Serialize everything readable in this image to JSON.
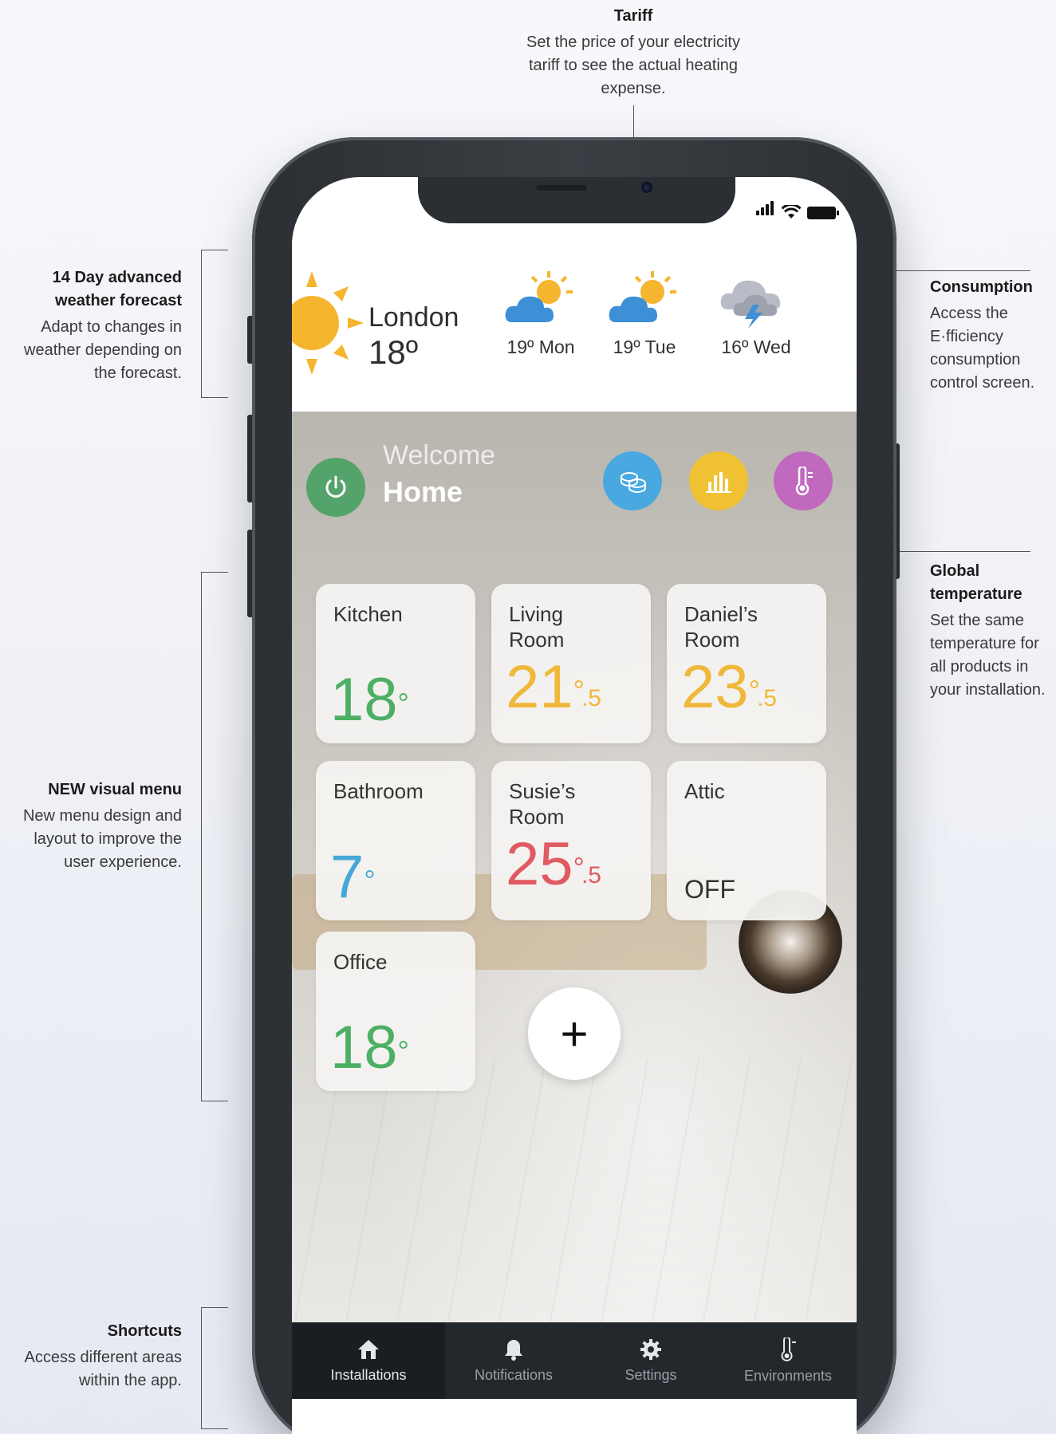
{
  "annotations": {
    "tariff": {
      "title": "Tariff",
      "text": "Set the price of your electricity tariff to see the actual heating expense."
    },
    "weather": {
      "title": "14 Day advanced weather forecast",
      "text": "Adapt to changes in weather depending on the forecast."
    },
    "consumption": {
      "title": "Consumption",
      "text": "Access the E·fficiency consumption control screen."
    },
    "global": {
      "title": "Global temperature",
      "text": "Set the same temperature for all products in your installation."
    },
    "menu": {
      "title": "NEW visual menu",
      "text": "New menu design and layout to improve the user experience."
    },
    "shortcuts": {
      "title": "Shortcuts",
      "text": "Access different areas within the app."
    }
  },
  "weather": {
    "city": "London",
    "temp": "18º",
    "days": [
      {
        "label": "19º Mon",
        "icon": "sun-cloud-icon"
      },
      {
        "label": "19º Tue",
        "icon": "sun-cloud-icon"
      },
      {
        "label": "16º Wed",
        "icon": "storm-icon"
      }
    ]
  },
  "header": {
    "welcome": "Welcome",
    "home": "Home"
  },
  "rooms": [
    {
      "name": "Kitchen",
      "temp": "18",
      "deg": "°",
      "frac": "",
      "color": "#4caf64"
    },
    {
      "name": "Living Room",
      "temp": "21",
      "deg": "°",
      "frac": ".5",
      "color": "#f0b83a"
    },
    {
      "name": "Daniel’s Room",
      "temp": "23",
      "deg": "°",
      "frac": ".5",
      "color": "#f0b83a"
    },
    {
      "name": "Bathroom",
      "temp": "7",
      "deg": "°",
      "frac": "",
      "color": "#46a8d8"
    },
    {
      "name": "Susie’s Room",
      "temp": "25",
      "deg": "°",
      "frac": ".5",
      "color": "#e05a63"
    },
    {
      "name": "Attic",
      "off": "OFF"
    },
    {
      "name": "Office",
      "temp": "18",
      "deg": "°",
      "frac": "",
      "color": "#4caf64"
    }
  ],
  "add_label": "+",
  "tabs": [
    {
      "label": "Installations",
      "icon": "home-icon",
      "active": true
    },
    {
      "label": "Notifications",
      "icon": "bell-icon"
    },
    {
      "label": "Settings",
      "icon": "gear-icon"
    },
    {
      "label": "Environments",
      "icon": "thermometer-icon"
    }
  ]
}
